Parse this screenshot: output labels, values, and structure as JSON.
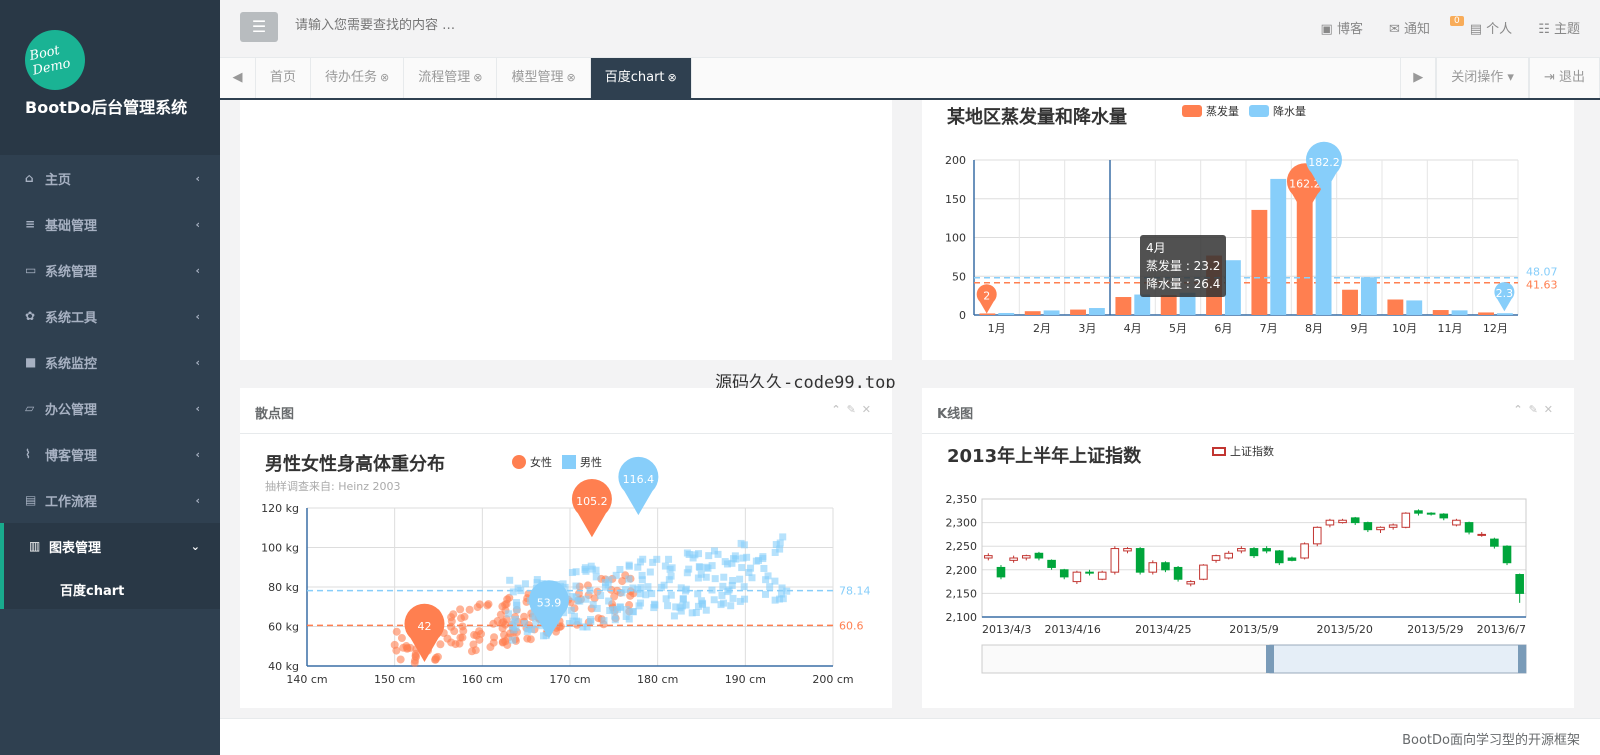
{
  "sidebar": {
    "logo_text": "Boot Demo",
    "brand": "BootDo后台管理系统",
    "items": [
      {
        "label": "主页"
      },
      {
        "label": "基础管理"
      },
      {
        "label": "系统管理"
      },
      {
        "label": "系统工具"
      },
      {
        "label": "系统监控"
      },
      {
        "label": "办公管理"
      },
      {
        "label": "博客管理"
      },
      {
        "label": "工作流程"
      },
      {
        "label": "图表管理"
      }
    ],
    "sub_item": "百度chart"
  },
  "topbar": {
    "search_placeholder": "请输入您需要查找的内容 …",
    "blog": "博客",
    "notify": "通知",
    "notify_badge": "0",
    "personal": "个人",
    "theme": "主题"
  },
  "tabs": {
    "items": [
      "首页",
      "待办任务",
      "流程管理",
      "模型管理",
      "百度chart"
    ],
    "close_ops": "关闭操作",
    "logout": "退出"
  },
  "bar_chart": {
    "title": "某地区蒸发量和降水量",
    "legend": [
      "蒸发量",
      "降水量"
    ],
    "tooltip": {
      "month": "4月",
      "evap": "蒸发量 : 23.2",
      "rain": "降水量 : 26.4"
    }
  },
  "scatter_panel": {
    "header": "散点图",
    "title": "男性女性身高体重分布",
    "subtitle": "抽样调查来自: Heinz  2003",
    "legend": [
      "女性",
      "男性"
    ]
  },
  "kline_panel": {
    "header": "K线图",
    "title": "2013年上半年上证指数",
    "legend": "上证指数"
  },
  "watermark": "源码久久-code99.top",
  "footer": "BootDo面向学习型的开源框架",
  "colors": {
    "evap": "#ff7f50",
    "rain": "#87cefa",
    "up": "#c23531",
    "down": "#00a53b"
  },
  "chart_data": [
    {
      "type": "bar",
      "title": "某地区蒸发量和降水量",
      "categories": [
        "1月",
        "2月",
        "3月",
        "4月",
        "5月",
        "6月",
        "7月",
        "8月",
        "9月",
        "10月",
        "11月",
        "12月"
      ],
      "series": [
        {
          "name": "蒸发量",
          "values": [
            2.0,
            4.9,
            7.0,
            23.2,
            25.6,
            76.7,
            135.6,
            162.2,
            32.6,
            20.0,
            6.4,
            3.3
          ],
          "markline": 41.63,
          "markpoints": [
            "2",
            "162.2"
          ]
        },
        {
          "name": "降水量",
          "values": [
            2.6,
            5.9,
            9.0,
            26.4,
            28.7,
            70.7,
            175.6,
            182.2,
            48.7,
            18.8,
            6.0,
            2.3
          ],
          "markline": 48.07,
          "markpoints": [
            "182.2",
            "2.3"
          ]
        }
      ],
      "y_ticks": [
        "0",
        "50",
        "100",
        "150",
        "200"
      ],
      "markline_labels": [
        "48.07",
        "41.63"
      ],
      "ylim": [
        0,
        200
      ]
    },
    {
      "type": "scatter",
      "title": "男性女性身高体重分布",
      "x_ticks": [
        "140 cm",
        "150 cm",
        "160 cm",
        "170 cm",
        "180 cm",
        "190 cm",
        "200 cm"
      ],
      "y_ticks": [
        "40 kg",
        "60 kg",
        "80 kg",
        "100 kg",
        "120 kg"
      ],
      "xlim": [
        140,
        200
      ],
      "ylim": [
        40,
        120
      ],
      "series": [
        {
          "name": "女性",
          "markline": 60.6,
          "markline_label": "60.6",
          "markpoints": [
            {
              "label": "105.2",
              "x": 172.5,
              "y": 105.2
            },
            {
              "label": "42",
              "x": 153.4,
              "y": 42
            }
          ]
        },
        {
          "name": "男性",
          "markline": 78.14,
          "markline_label": "78.14",
          "markpoints": [
            {
              "label": "116.4",
              "x": 177.8,
              "y": 116.4
            },
            {
              "label": "53.9",
              "x": 167.6,
              "y": 53.9
            }
          ]
        }
      ]
    },
    {
      "type": "candlestick",
      "title": "2013年上半年上证指数",
      "x_ticks": [
        "2013/4/3",
        "2013/4/16",
        "2013/4/25",
        "2013/5/9",
        "2013/5/20",
        "2013/5/29",
        "2013/6/7"
      ],
      "y_ticks": [
        "2,100",
        "2,150",
        "2,200",
        "2,250",
        "2,300",
        "2,350"
      ],
      "ylim": [
        2100,
        2350
      ],
      "candles": [
        [
          2225,
          2230,
          2220,
          2235
        ],
        [
          2205,
          2185,
          2180,
          2210
        ],
        [
          2220,
          2225,
          2215,
          2230
        ],
        [
          2225,
          2230,
          2220,
          2232
        ],
        [
          2235,
          2225,
          2220,
          2238
        ],
        [
          2220,
          2205,
          2200,
          2222
        ],
        [
          2200,
          2185,
          2180,
          2202
        ],
        [
          2175,
          2195,
          2170,
          2198
        ],
        [
          2195,
          2193,
          2188,
          2200
        ],
        [
          2180,
          2195,
          2178,
          2198
        ],
        [
          2195,
          2245,
          2190,
          2250
        ],
        [
          2240,
          2245,
          2235,
          2248
        ],
        [
          2245,
          2195,
          2190,
          2248
        ],
        [
          2195,
          2215,
          2190,
          2220
        ],
        [
          2215,
          2200,
          2195,
          2218
        ],
        [
          2205,
          2180,
          2175,
          2208
        ],
        [
          2170,
          2175,
          2165,
          2178
        ],
        [
          2180,
          2210,
          2178,
          2212
        ],
        [
          2220,
          2230,
          2215,
          2232
        ],
        [
          2225,
          2235,
          2222,
          2240
        ],
        [
          2240,
          2245,
          2235,
          2250
        ],
        [
          2245,
          2230,
          2225,
          2248
        ],
        [
          2245,
          2240,
          2235,
          2250
        ],
        [
          2240,
          2215,
          2210,
          2242
        ],
        [
          2225,
          2220,
          2218,
          2228
        ],
        [
          2225,
          2255,
          2222,
          2258
        ],
        [
          2255,
          2290,
          2250,
          2292
        ],
        [
          2295,
          2305,
          2290,
          2308
        ],
        [
          2300,
          2305,
          2298,
          2308
        ],
        [
          2310,
          2300,
          2295,
          2312
        ],
        [
          2300,
          2285,
          2280,
          2302
        ],
        [
          2285,
          2290,
          2278,
          2292
        ],
        [
          2290,
          2295,
          2285,
          2298
        ],
        [
          2290,
          2320,
          2288,
          2322
        ],
        [
          2325,
          2320,
          2315,
          2328
        ],
        [
          2320,
          2318,
          2315,
          2322
        ],
        [
          2318,
          2310,
          2305,
          2320
        ],
        [
          2295,
          2305,
          2292,
          2308
        ],
        [
          2300,
          2280,
          2275,
          2302
        ],
        [
          2275,
          2275,
          2270,
          2280
        ],
        [
          2265,
          2250,
          2245,
          2268
        ],
        [
          2250,
          2215,
          2210,
          2252
        ],
        [
          2190,
          2150,
          2130,
          2192
        ]
      ]
    }
  ]
}
